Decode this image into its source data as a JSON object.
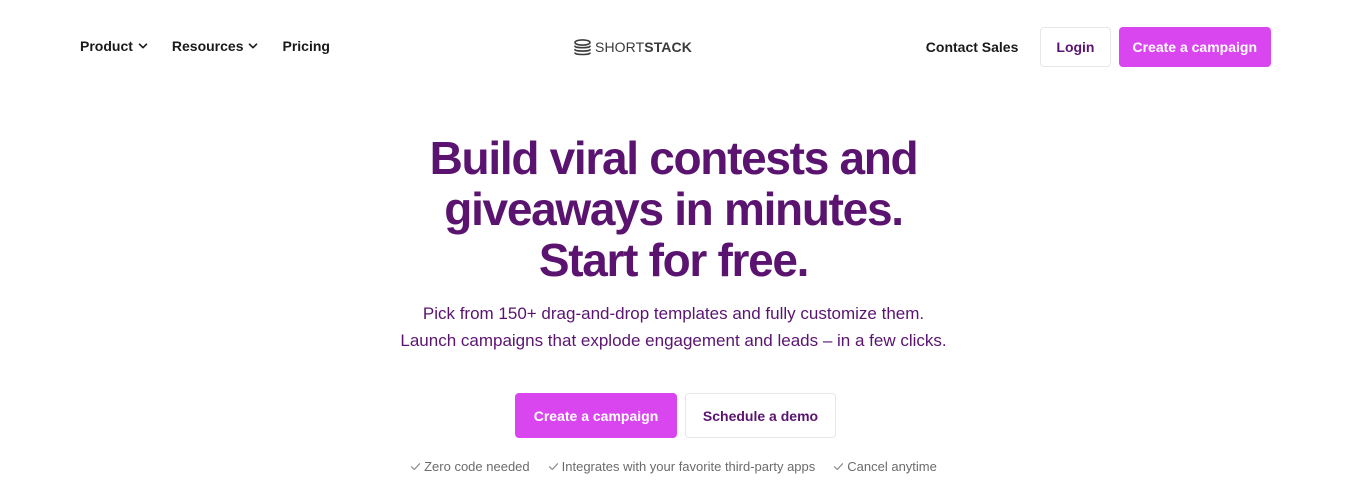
{
  "header": {
    "nav": [
      {
        "label": "Product",
        "has_dropdown": true
      },
      {
        "label": "Resources",
        "has_dropdown": true
      },
      {
        "label": "Pricing",
        "has_dropdown": false
      }
    ],
    "logo": {
      "part1": "SHORT",
      "part2": "STACK"
    },
    "contact_label": "Contact Sales",
    "login_label": "Login",
    "cta_label": "Create a campaign"
  },
  "hero": {
    "title_lines": [
      "Build viral contests and",
      "giveaways in minutes.",
      "Start for free."
    ],
    "subtitle_lines": [
      "Pick from 150+ drag-and-drop templates and fully customize them.",
      "Launch campaigns that explode engagement and leads – in a few clicks."
    ],
    "primary_cta": "Create a campaign",
    "secondary_cta": "Schedule a demo",
    "perks": [
      "Zero code needed",
      "Integrates with your favorite third-party apps",
      "Cancel anytime"
    ]
  },
  "colors": {
    "accent": "#d946ef",
    "heading": "#5a1470",
    "muted": "#6b6b6b"
  },
  "icons": {
    "dropdown": "chevron-down-icon",
    "perk": "check-icon",
    "logo": "stack-logo-icon"
  }
}
